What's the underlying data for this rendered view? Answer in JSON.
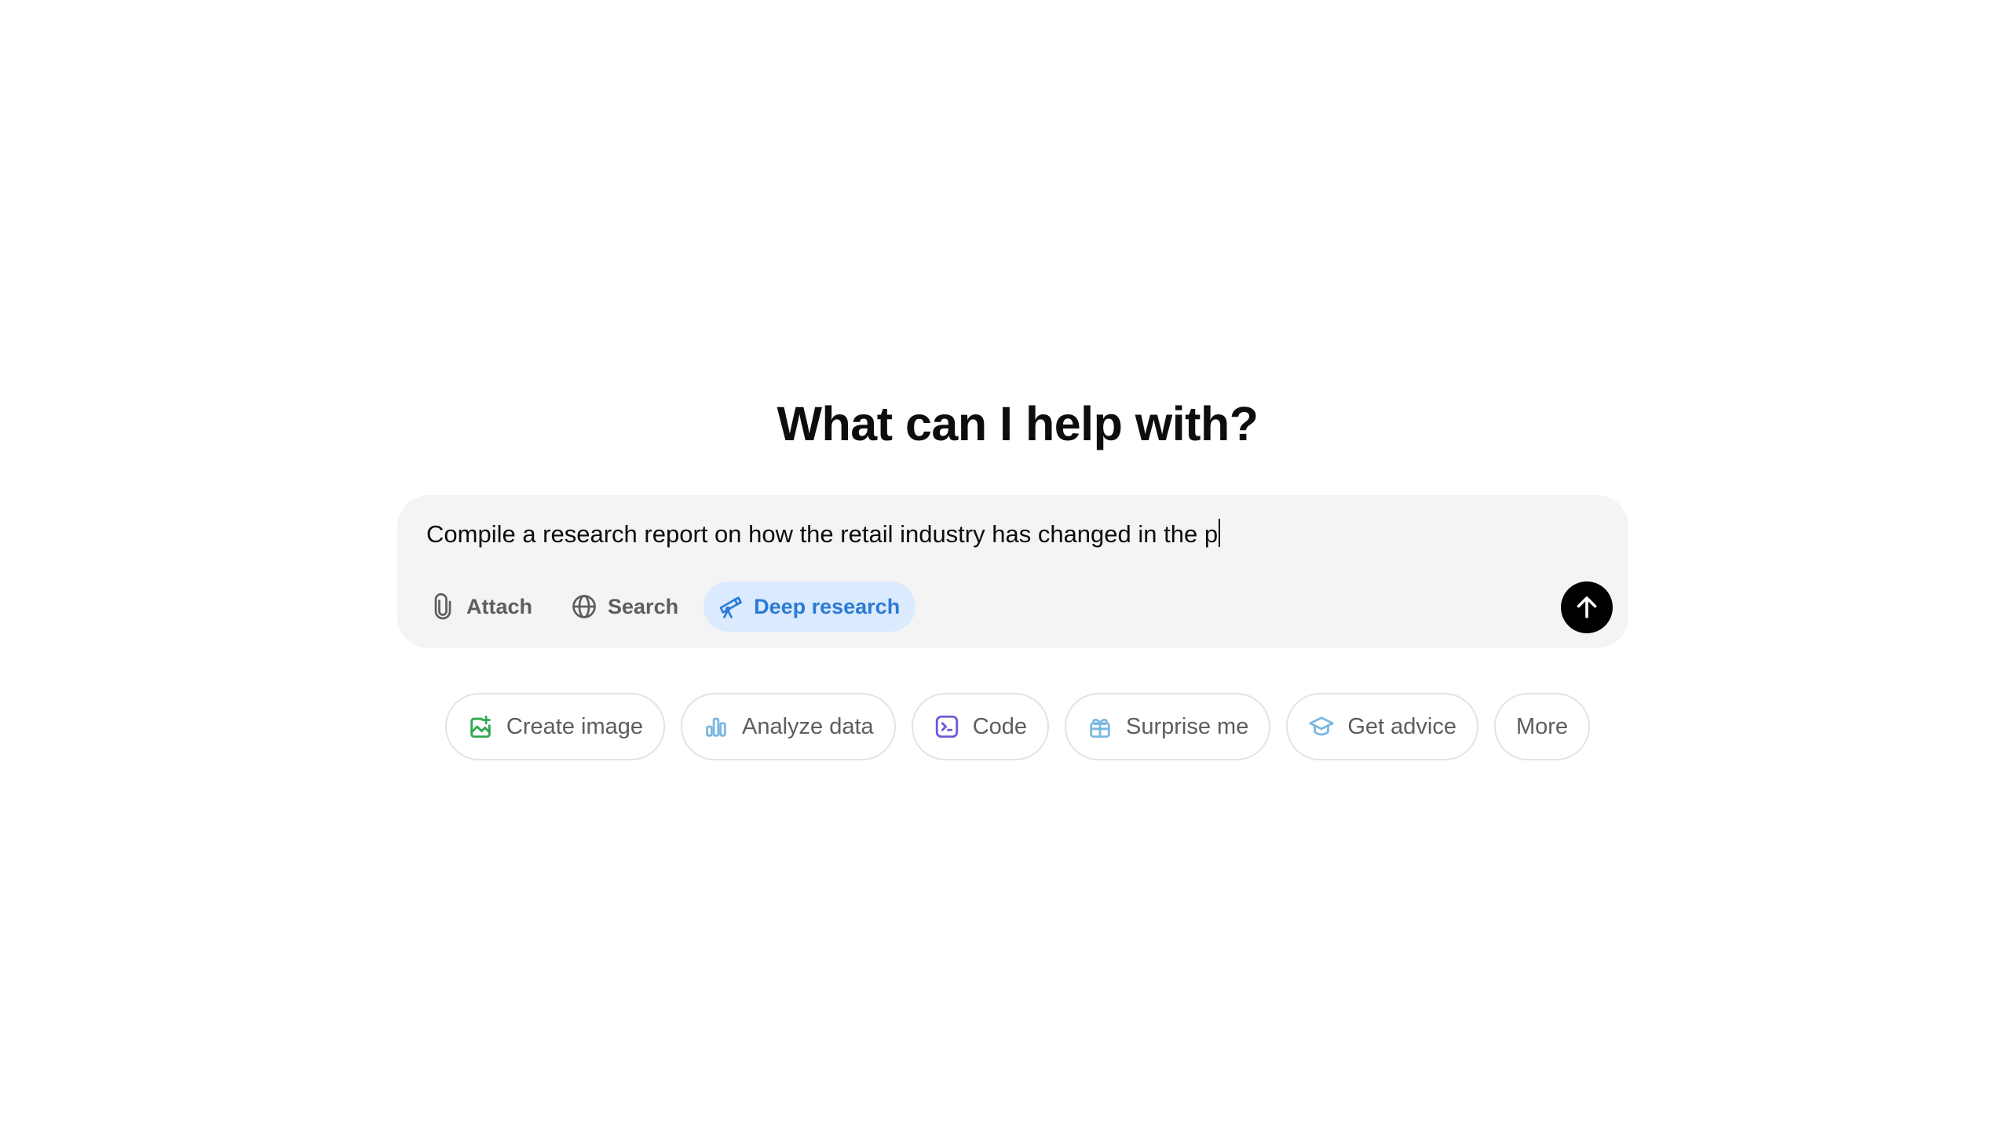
{
  "heading": "What can I help with?",
  "composer": {
    "text": "Compile a research report on how the retail industry has changed in the p",
    "tools": [
      {
        "label": "Attach",
        "icon": "paperclip-icon"
      },
      {
        "label": "Search",
        "icon": "globe-icon"
      },
      {
        "label": "Deep research",
        "icon": "telescope-icon",
        "active": true
      }
    ],
    "send_icon": "arrow-up-icon"
  },
  "chips": [
    {
      "label": "Create image",
      "icon": "image-icon",
      "color": "#2fa84f"
    },
    {
      "label": "Analyze data",
      "icon": "bar-chart-icon",
      "color": "#7ab8e0"
    },
    {
      "label": "Code",
      "icon": "terminal-icon",
      "color": "#6b5bd6"
    },
    {
      "label": "Surprise me",
      "icon": "gift-icon",
      "color": "#7ab8e0"
    },
    {
      "label": "Get advice",
      "icon": "graduation-cap-icon",
      "color": "#7ab8e0"
    },
    {
      "label": "More"
    }
  ],
  "colors": {
    "composer_bg": "#f4f4f4",
    "active_tool_bg": "#dbeafe",
    "active_tool_text": "#2a7bd6",
    "send_button": "#000000"
  }
}
